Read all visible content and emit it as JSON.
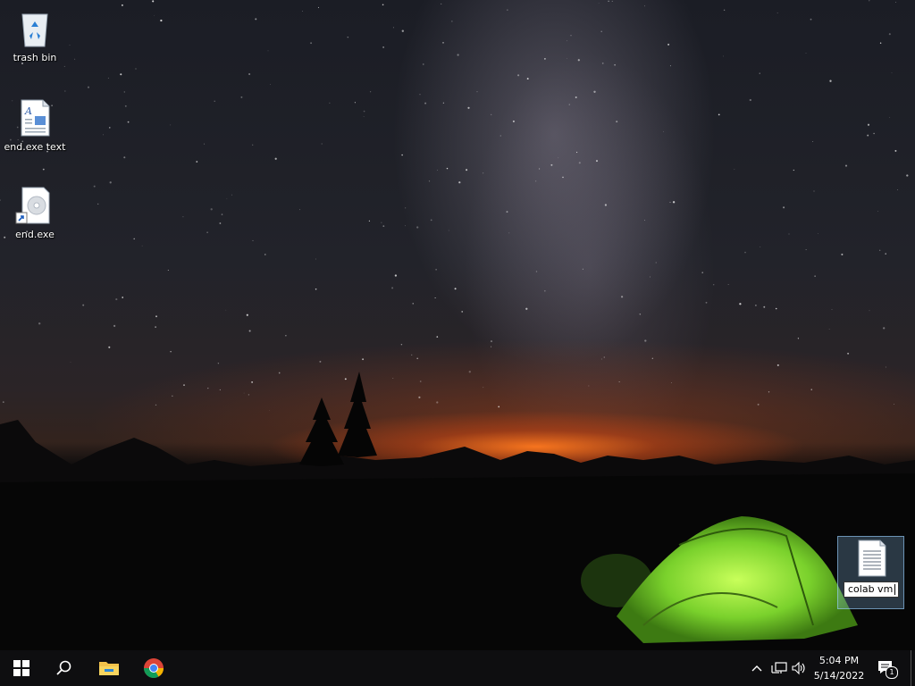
{
  "desktop": {
    "icons": [
      {
        "label": "trash bin",
        "icon": "recycle-bin-icon"
      },
      {
        "label": "end.exe text",
        "icon": "text-document-icon"
      },
      {
        "label": "end.exe",
        "icon": "shortcut-exe-icon"
      }
    ],
    "rename": {
      "icon": "text-file-icon",
      "value": "colab vm"
    }
  },
  "taskbar": {
    "items": [
      "windows-start-icon",
      "search-icon",
      "file-explorer-icon",
      "chrome-icon"
    ],
    "tray_icons": [
      "chevron-up-icon",
      "network-icon",
      "volume-icon"
    ],
    "time": "5:04 PM",
    "date": "5/14/2022",
    "notification_count": "1"
  },
  "colors": {
    "taskbar": "#0e0e10",
    "tent": "#7ad12c",
    "horizon_glow": "#ff7a1e"
  }
}
